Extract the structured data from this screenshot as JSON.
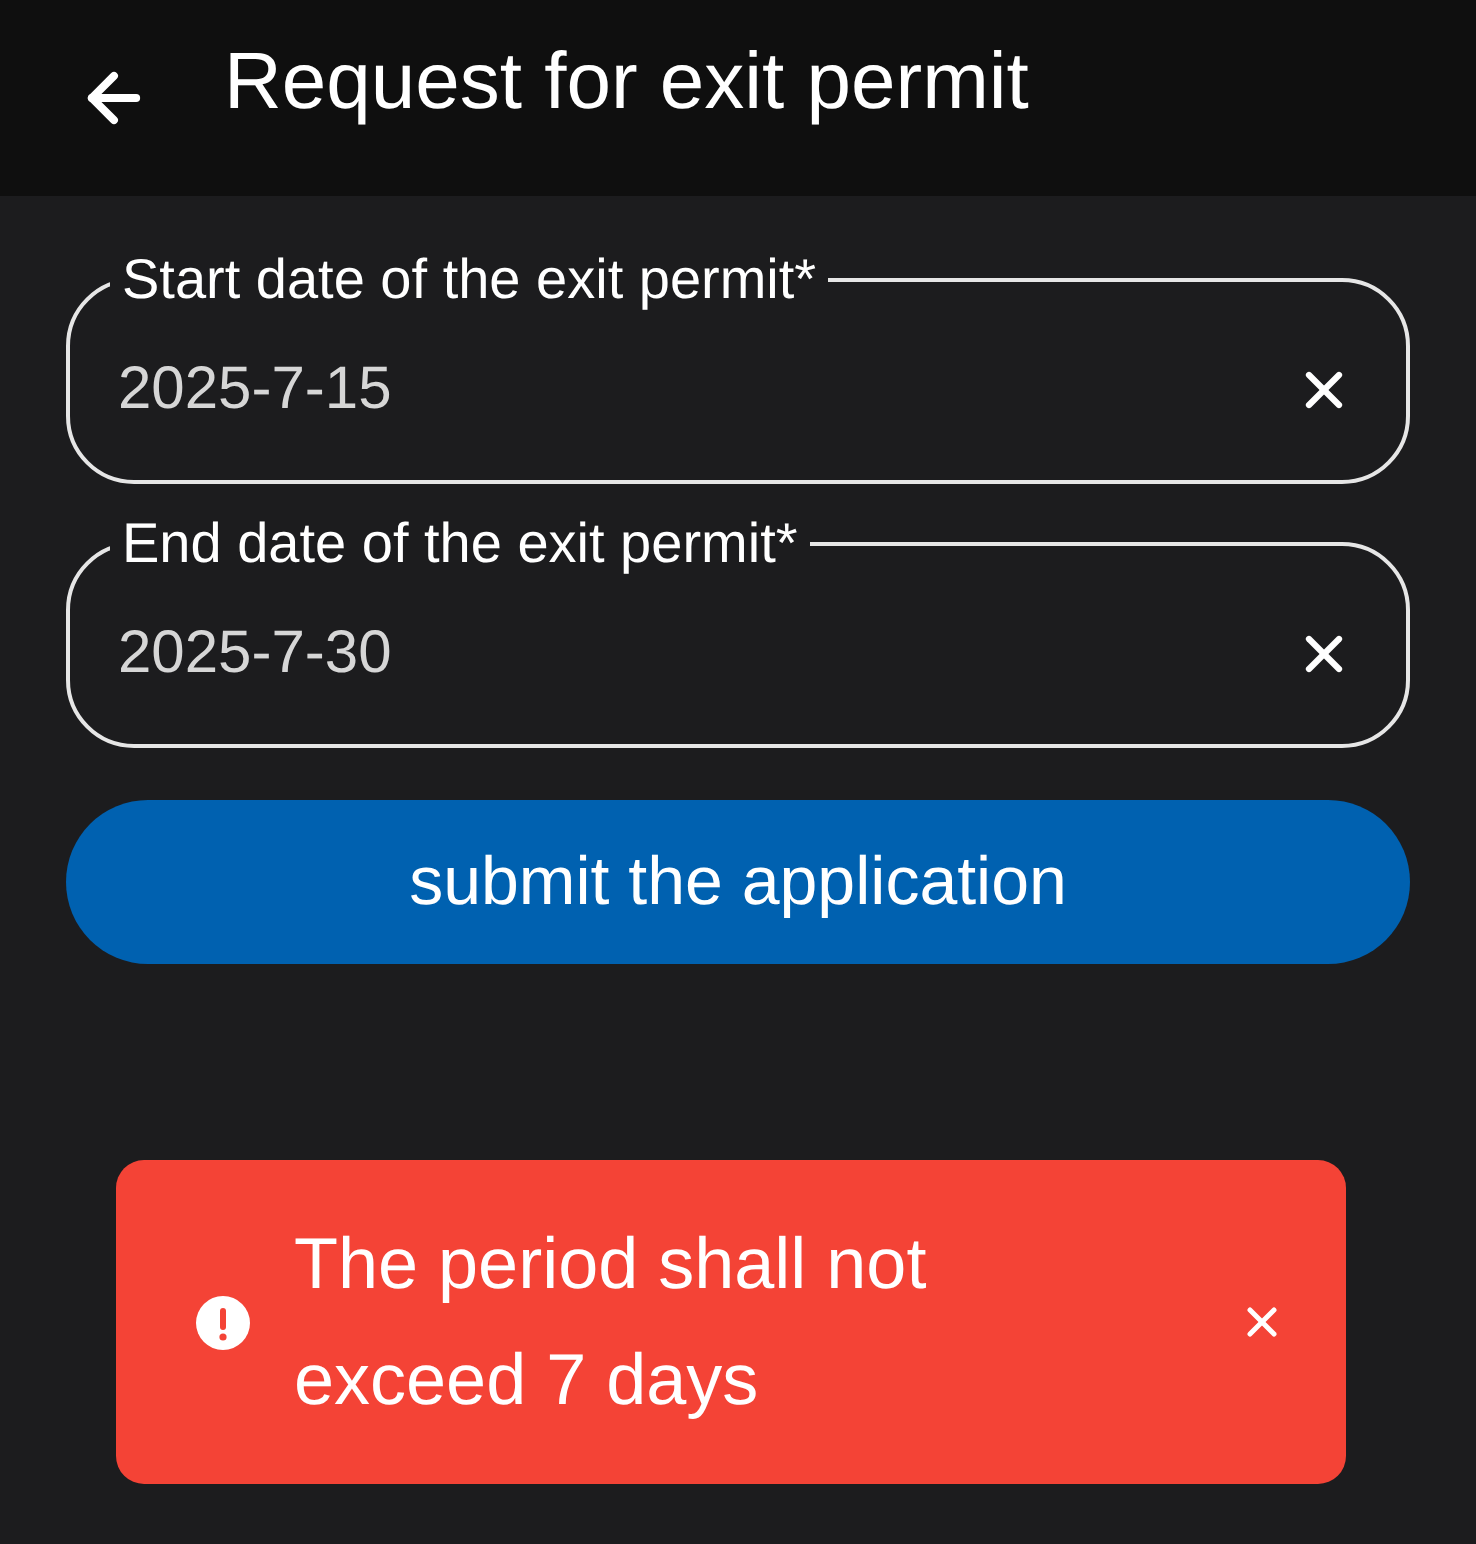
{
  "header": {
    "title": "Request for exit permit"
  },
  "fields": [
    {
      "label": "Start date of the exit permit*",
      "value": "2025-7-15"
    },
    {
      "label": "End date of the exit permit*",
      "value": "2025-7-30"
    }
  ],
  "submit_button": {
    "label": "submit the application"
  },
  "toast": {
    "kind": "error",
    "message": "The period shall not exceed 7 days"
  }
}
